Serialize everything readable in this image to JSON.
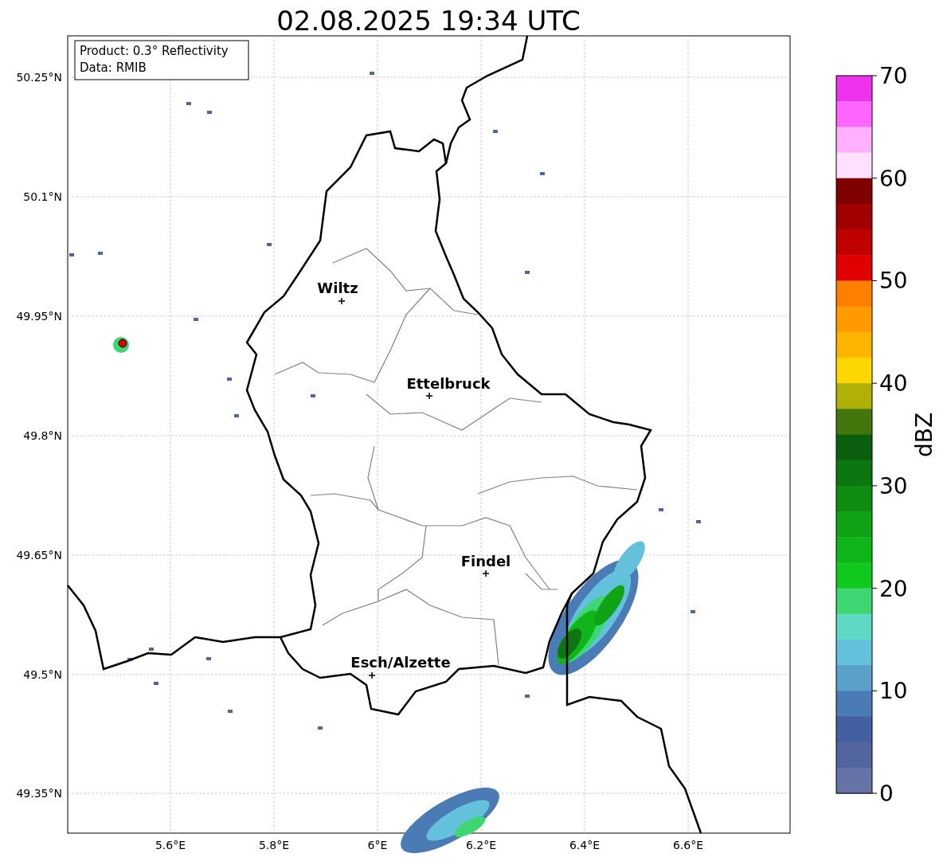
{
  "title": "02.08.2025 19:34 UTC",
  "legend": [
    "Product: 0.3° Reflectivity",
    "Data: RMIB"
  ],
  "y_ticks": [
    "50.25°N",
    "50.1°N",
    "49.95°N",
    "49.8°N",
    "49.65°N",
    "49.5°N",
    "49.35°N"
  ],
  "x_ticks": [
    "5.6°E",
    "5.8°E",
    "6°E",
    "6.2°E",
    "6.4°E",
    "6.6°E"
  ],
  "cities": [
    {
      "name": "Wiltz"
    },
    {
      "name": "Ettelbruck"
    },
    {
      "name": "Findel"
    },
    {
      "name": "Esch/Alzette"
    }
  ],
  "colorbar": {
    "label": "dBZ",
    "ticks": [
      "70",
      "60",
      "50",
      "40",
      "30",
      "20",
      "10",
      "0"
    ],
    "bands": [
      {
        "color": "#ee33ee"
      },
      {
        "color": "#ff66ff"
      },
      {
        "color": "#ffb0ff"
      },
      {
        "color": "#ffe0ff"
      },
      {
        "color": "#800000"
      },
      {
        "color": "#a00000"
      },
      {
        "color": "#c00000"
      },
      {
        "color": "#e00000"
      },
      {
        "color": "#ff7f00"
      },
      {
        "color": "#ff9a00"
      },
      {
        "color": "#ffb500"
      },
      {
        "color": "#ffd700"
      },
      {
        "color": "#b0b007"
      },
      {
        "color": "#43760c"
      },
      {
        "color": "#0a5e0c"
      },
      {
        "color": "#0c7710"
      },
      {
        "color": "#0e8c12"
      },
      {
        "color": "#0fa315"
      },
      {
        "color": "#10b51a"
      },
      {
        "color": "#11c91e"
      },
      {
        "color": "#3ed672"
      },
      {
        "color": "#5fd8c4"
      },
      {
        "color": "#63c1dc"
      },
      {
        "color": "#5aa0c8"
      },
      {
        "color": "#4a7bb4"
      },
      {
        "color": "#4560a2"
      },
      {
        "color": "#52659f"
      },
      {
        "color": "#6673a6"
      }
    ]
  }
}
